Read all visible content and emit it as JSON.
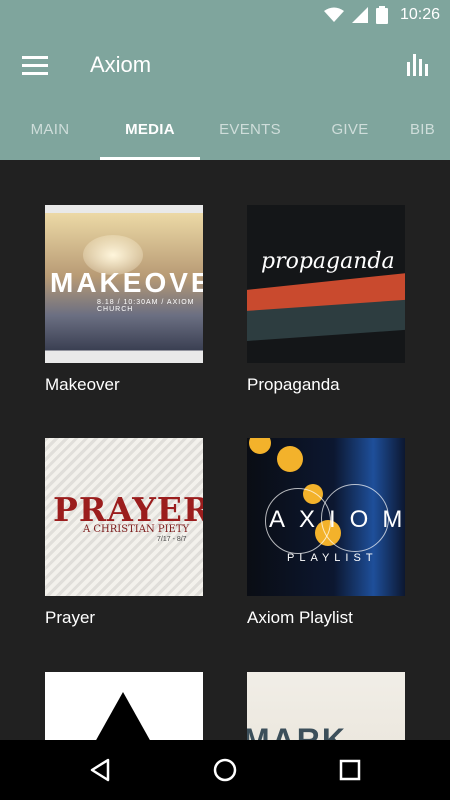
{
  "status": {
    "time": "10:26"
  },
  "app": {
    "title": "Axiom"
  },
  "tabs": [
    {
      "label": "MAIN"
    },
    {
      "label": "MEDIA",
      "active": true
    },
    {
      "label": "EVENTS"
    },
    {
      "label": "GIVE"
    },
    {
      "label": "BIB"
    }
  ],
  "media": [
    {
      "title": "Makeover",
      "art_text": "MAKEOVER",
      "art_sub": "8.18 / 10:30AM / AXIOM CHURCH"
    },
    {
      "title": "Propaganda",
      "art_text": "propaganda"
    },
    {
      "title": "Prayer",
      "art_text": "PRAYER",
      "art_sub": "A CHRISTIAN PIETY",
      "art_date": "7/17 - 8/7"
    },
    {
      "title": "Axiom Playlist",
      "art_text": "AXIOM",
      "art_sub": "PLAYLIST"
    },
    {
      "title": ""
    },
    {
      "title": "",
      "art_text": "MARK"
    }
  ],
  "colors": {
    "primary": "#7fa59d",
    "background": "#212121",
    "navbar": "#000000"
  },
  "icons": {
    "menu": "hamburger-menu-icon",
    "chart": "bar-chart-icon",
    "wifi": "wifi-icon",
    "signal": "cell-signal-icon",
    "battery": "battery-icon",
    "back": "back-triangle-icon",
    "home": "home-circle-icon",
    "recents": "recents-square-icon"
  }
}
